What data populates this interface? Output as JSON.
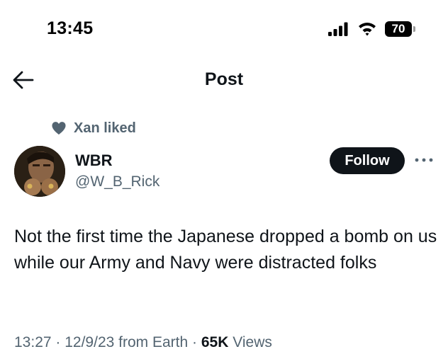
{
  "status_bar": {
    "time": "13:45",
    "battery": "70",
    "icons": [
      "signal-icon",
      "wifi-icon",
      "battery-icon"
    ]
  },
  "nav": {
    "title": "Post",
    "back_icon": "back-arrow-icon"
  },
  "social_context": {
    "icon": "heart-icon",
    "text": "Xan liked"
  },
  "author": {
    "display_name": "WBR",
    "handle": "@W_B_Rick",
    "follow_label": "Follow",
    "more_icon": "more-options-icon"
  },
  "tweet": {
    "text": "Not the first time the Japanese dropped a bomb on us while our Army and Navy were distracted folks"
  },
  "meta": {
    "time": "13:27",
    "sep1": " · ",
    "date": "12/9/23",
    "source": " from Earth",
    "sep2": " · ",
    "views_count": "65K",
    "views_label": " Views"
  },
  "colors": {
    "text_primary": "#0f1419",
    "text_secondary": "#536471",
    "follow_bg": "#0f1419",
    "background": "#ffffff"
  }
}
